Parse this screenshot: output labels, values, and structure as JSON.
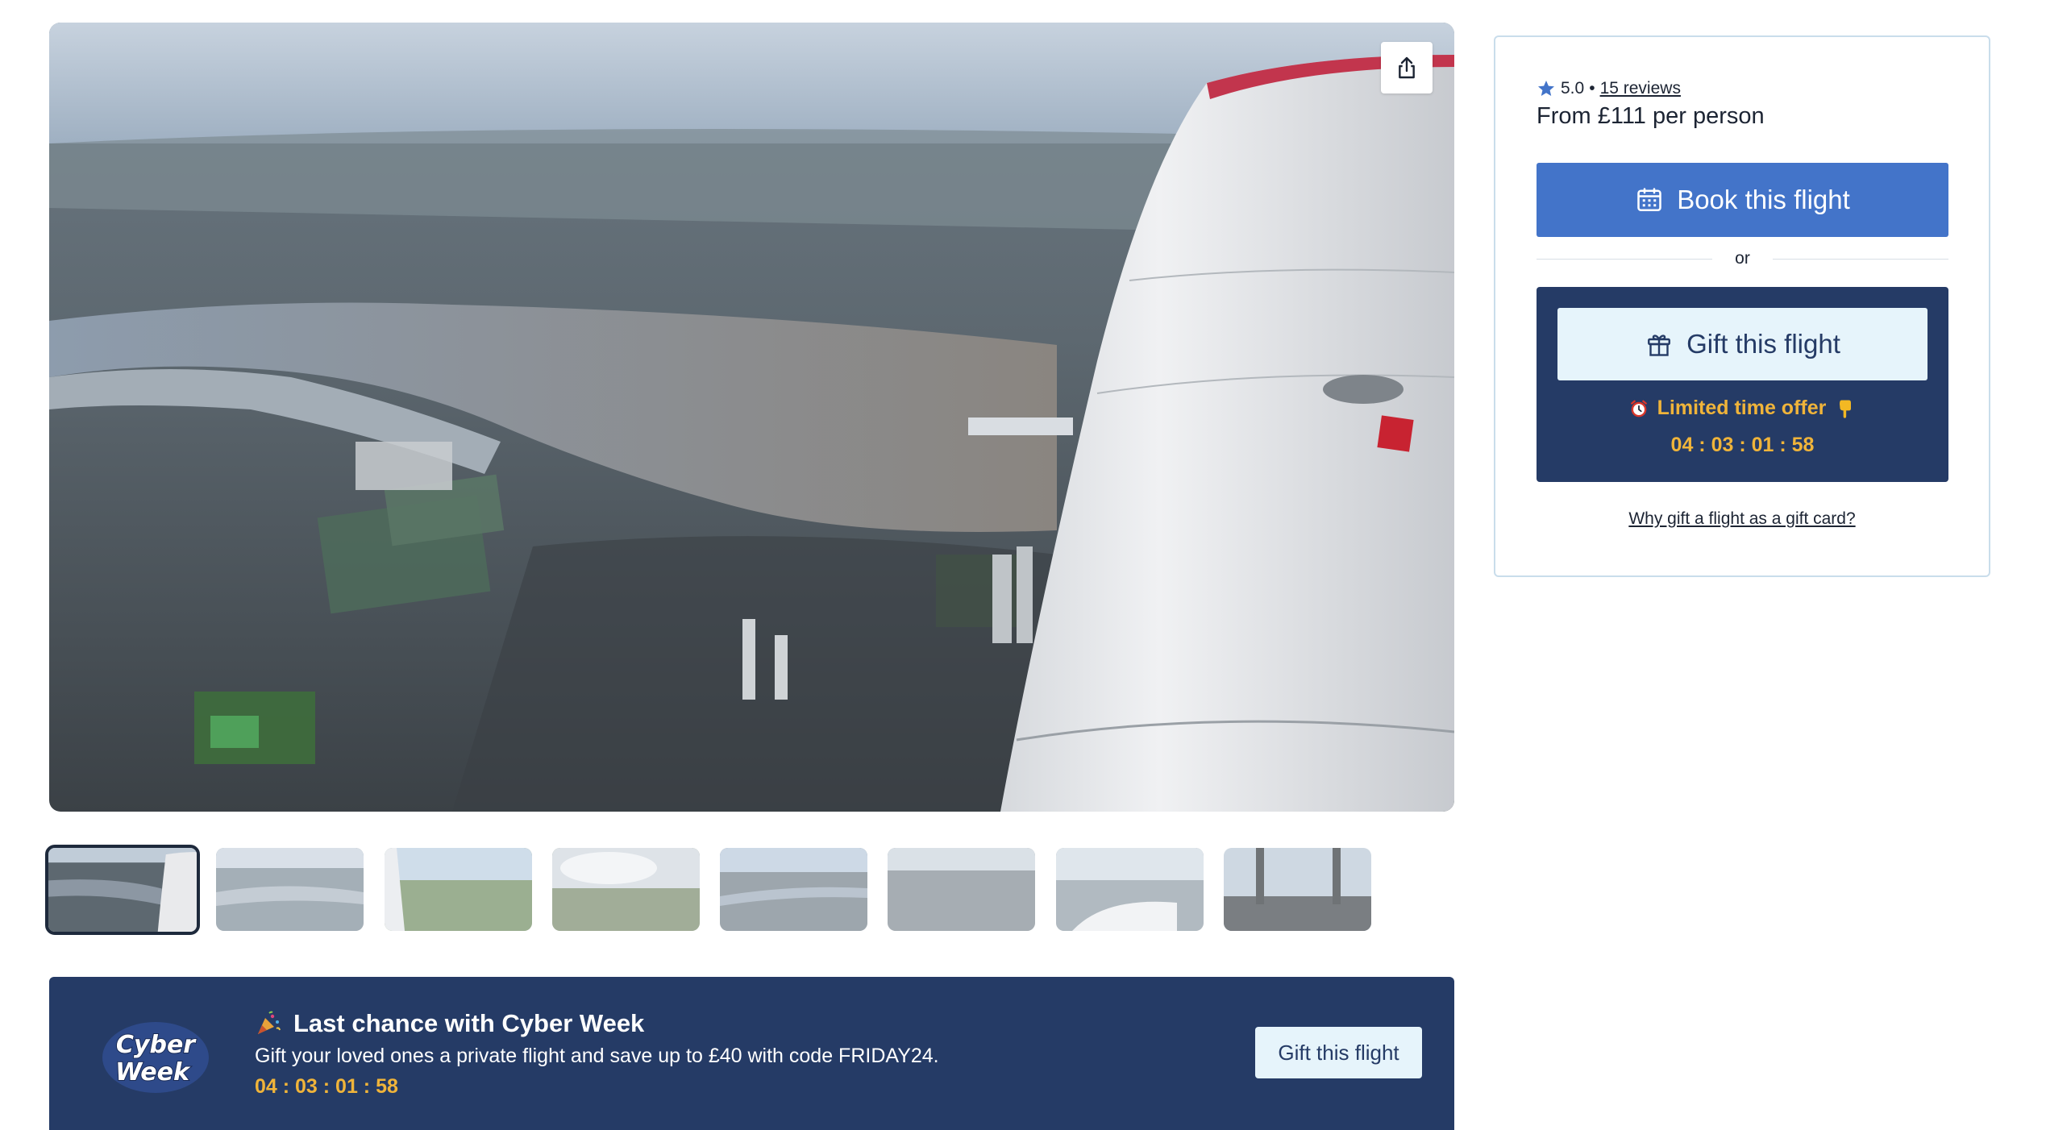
{
  "hero": {
    "image_description_icon": "aerial-photo",
    "share_icon": "share-icon"
  },
  "thumbnails": {
    "count": 8,
    "active_index": 0
  },
  "booking": {
    "rating_value": "5.0",
    "rating_separator": "•",
    "reviews_link": "15 reviews",
    "price": "From £111 per person",
    "book_button": "Book this flight",
    "or_text": "or",
    "gift_button": "Gift this flight",
    "offer_label": "Limited time offer",
    "offer_timer": "04 : 03 : 01 : 58",
    "why_gift_link": "Why gift a flight as a gift card?"
  },
  "promo": {
    "logo_text": "Cyber Week",
    "title": "Last chance with Cyber Week",
    "text": "Gift your loved ones a private flight and save up to £40 with code FRIDAY24.",
    "timer": "04 : 03 : 01 : 58",
    "button": "Gift this flight"
  },
  "colors": {
    "primary": "#4374c9",
    "navy": "#253b66",
    "accent": "#f0b43a",
    "light": "#e6f4fb"
  }
}
